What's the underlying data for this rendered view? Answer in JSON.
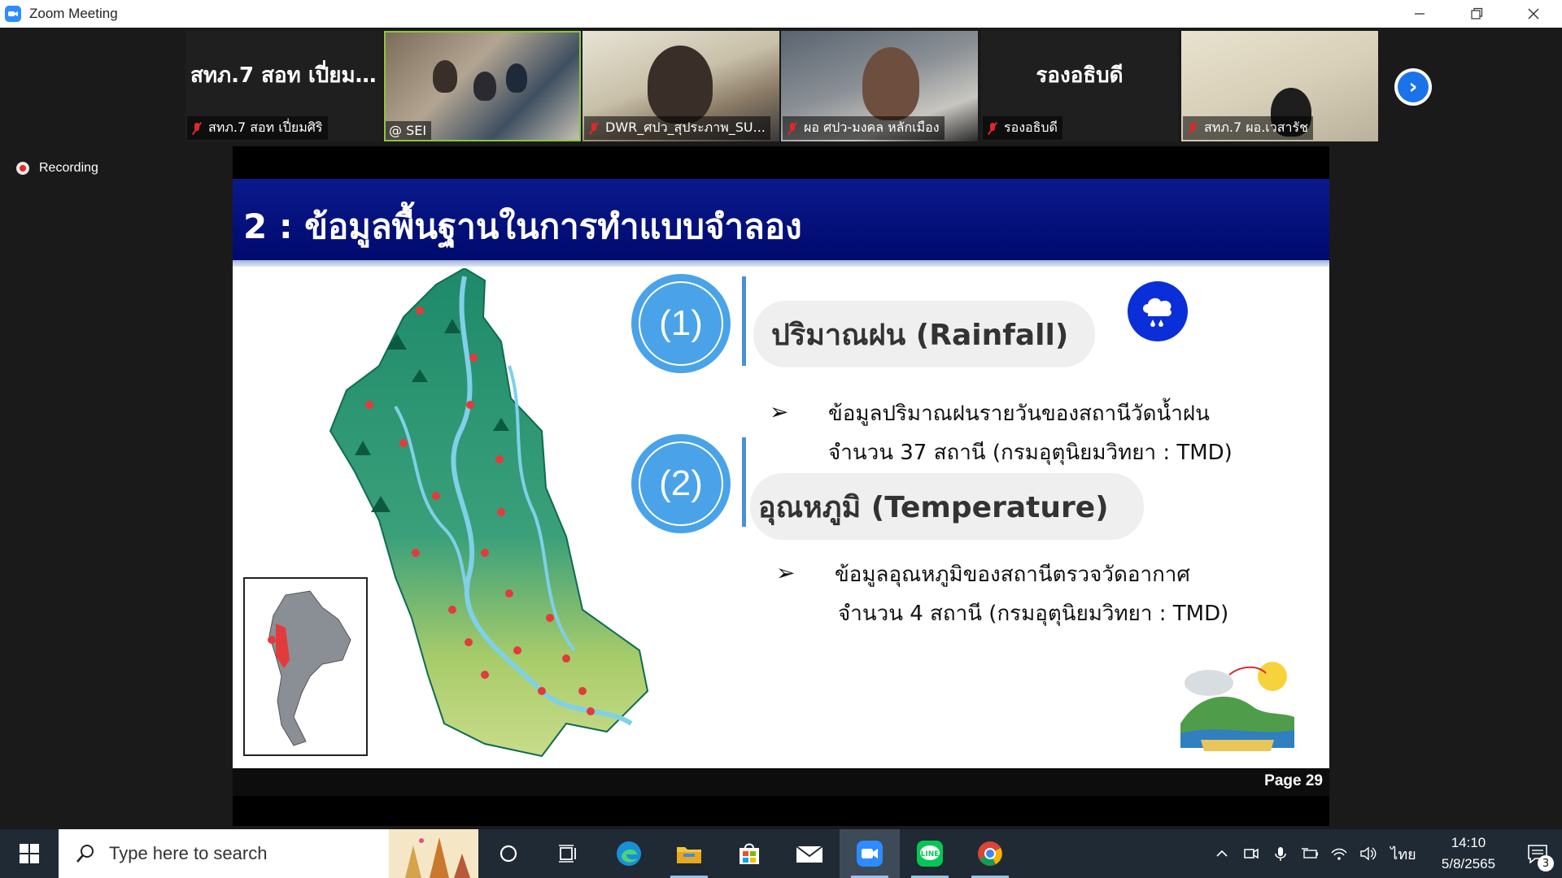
{
  "window": {
    "title": "Zoom Meeting"
  },
  "participants": [
    {
      "display_name": "สทภ.7 สอท เปี่ยม...",
      "label": "สทภ.7 สอท เปี่ยมศิริ",
      "muted": true,
      "video": false
    },
    {
      "display_name": "",
      "label": "@ SEI",
      "muted": false,
      "video": true,
      "active_speaker": true
    },
    {
      "display_name": "",
      "label": "DWR_ศปว_สุประภาพ_SU...",
      "muted": true,
      "video": true
    },
    {
      "display_name": "",
      "label": "ผอ ศปว-มงคล หลักเมือง",
      "muted": true,
      "video": true
    },
    {
      "display_name": "รองอธิบดี",
      "label": "รองอธิบดี",
      "muted": true,
      "video": false
    },
    {
      "display_name": "",
      "label": "สทภ.7 ผอ.เวสารัช",
      "muted": true,
      "video": true
    }
  ],
  "recording": {
    "label": "Recording"
  },
  "slide": {
    "title": "2 : ข้อมูลพื้นฐานในการทำแบบจำลอง",
    "items": [
      {
        "number": "(1)",
        "heading": "ปริมาณฝน  (Rainfall)",
        "line1": "ข้อมูลปริมาณฝนรายวันของสถานีวัดน้ำฝน",
        "line2": "จำนวน 37 สถานี (กรมอุตุนิยมวิทยา : TMD)"
      },
      {
        "number": "(2)",
        "heading": "อุณหภูมิ (Temperature)",
        "line1": "ข้อมูลอุณหภูมิของสถานีตรวจวัดอากาศ",
        "line2": "จำนวน 4 สถานี (กรมอุตุนิยมวิทยา : TMD)"
      }
    ],
    "bullet_glyph": "➢",
    "page": "Page 29"
  },
  "taskbar": {
    "search_placeholder": "Type here to search",
    "language": "ไทย",
    "time": "14:10",
    "date": "5/8/2565",
    "notifications": "3"
  },
  "colors": {
    "header": "#0a1a8c",
    "circle": "#4aa3e8",
    "rain_icon": "#0a2ed8",
    "zoom_blue": "#2d8cff",
    "active_speaker": "#8cc63f"
  }
}
